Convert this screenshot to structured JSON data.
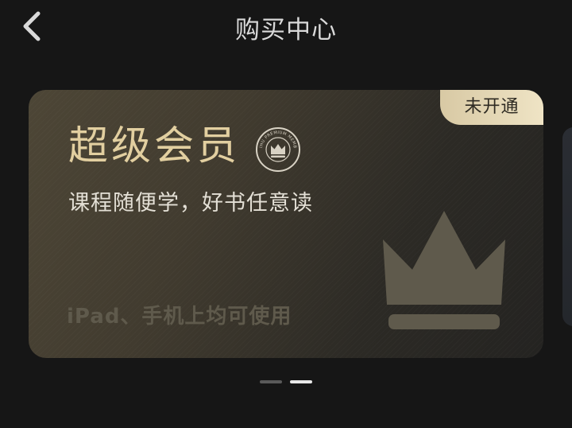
{
  "header": {
    "title": "购买中心"
  },
  "card": {
    "title": "超级会员",
    "subtitle": "课程随便学，好书任意读",
    "status_badge": "未开通",
    "footer_note": "iPad、手机上均可使用",
    "seal_text": "ZHIHU PREMIUM MEMBER"
  },
  "pager": {
    "total": 2,
    "active_index": 1
  },
  "colors": {
    "background": "#161616",
    "card_title_gold": "#e2cfa0",
    "badge_gold": "#efe4c5",
    "crown": "#5f5a4c"
  },
  "icons": {
    "back": "chevron-left-icon",
    "seal": "premium-seal-icon",
    "crown": "crown-icon"
  }
}
